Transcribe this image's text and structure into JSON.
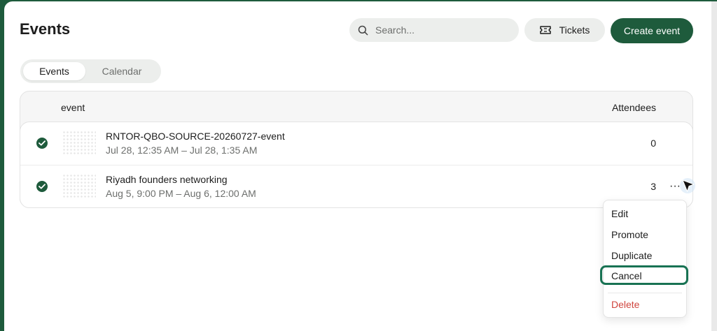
{
  "header": {
    "title": "Events",
    "search_placeholder": "Search...",
    "tickets_label": "Tickets",
    "create_label": "Create event"
  },
  "view_toggle": {
    "options": [
      "Events",
      "Calendar"
    ],
    "selected": "Events"
  },
  "table": {
    "columns": {
      "event": "event",
      "attendees": "Attendees"
    },
    "rows": [
      {
        "title": "RNTOR-QBO-SOURCE-20260727-event",
        "date": "Jul 28, 12:35 AM – Jul 28, 1:35 AM",
        "attendees": "0",
        "status": "published"
      },
      {
        "title": "Riyadh founders networking",
        "date": "Aug 5, 9:00 PM – Aug 6, 12:00 AM",
        "attendees": "3",
        "status": "published"
      }
    ]
  },
  "row_menu": {
    "more_label": "···",
    "items": [
      "Edit",
      "Promote",
      "Duplicate",
      "Cancel"
    ],
    "danger_item": "Delete",
    "focused_item": "Cancel"
  },
  "icons": {
    "search": "search-icon",
    "tickets": "ticket-icon",
    "status": "check-circle-icon",
    "more": "more-horizontal-icon",
    "cursor": "mouse-pointer-icon"
  },
  "colors": {
    "brand": "#1e5b3c",
    "focus_ring": "#187253",
    "danger": "#d0453e",
    "muted_text": "#6d6f6d",
    "pill_bg": "#eceeec"
  }
}
